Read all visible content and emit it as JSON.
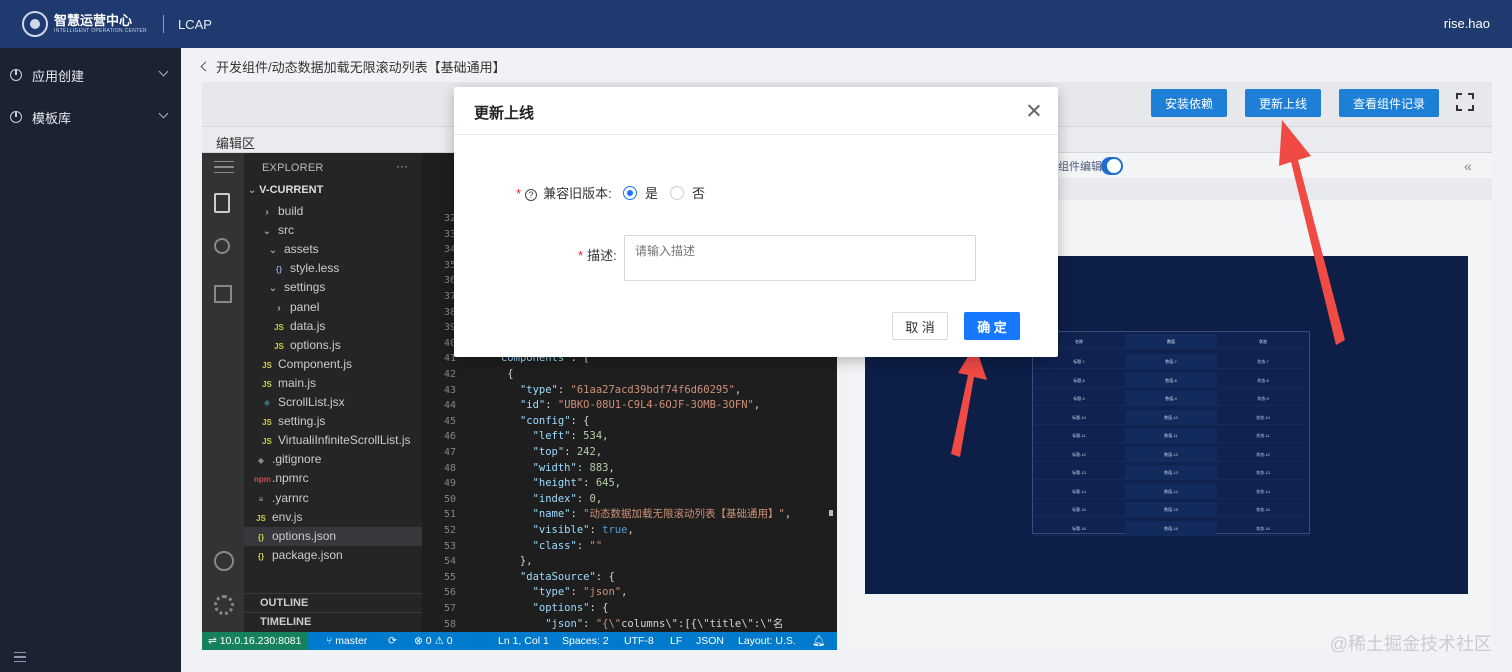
{
  "header": {
    "logo_cn": "智慧运营中心",
    "logo_en": "INTELLIGENT OPERATION CENTER",
    "app_name": "LCAP",
    "user": "rise.hao"
  },
  "sidebar": {
    "items": [
      {
        "label": "应用创建"
      },
      {
        "label": "模板库"
      }
    ]
  },
  "breadcrumb": {
    "text": "开发组件/动态数据加载无限滚动列表【基础通用】"
  },
  "toolbar": {
    "install_label": "安装依赖",
    "update_label": "更新上线",
    "history_label": "查看组件记录"
  },
  "editor": {
    "title": "编辑区",
    "explorer_title": "EXPLORER",
    "explorer_more": "···",
    "root": "V-CURRENT",
    "tree": [
      {
        "name": "build",
        "type": "folder"
      },
      {
        "name": "src",
        "type": "folder-open"
      },
      {
        "name": "assets",
        "type": "folder-open"
      },
      {
        "name": "style.less",
        "type": "less"
      },
      {
        "name": "settings",
        "type": "folder-open"
      },
      {
        "name": "panel",
        "type": "folder"
      },
      {
        "name": "data.js",
        "type": "js"
      },
      {
        "name": "options.js",
        "type": "js"
      },
      {
        "name": "Component.js",
        "type": "js"
      },
      {
        "name": "main.js",
        "type": "js"
      },
      {
        "name": "ScrollList.jsx",
        "type": "jsx"
      },
      {
        "name": "setting.js",
        "type": "js"
      },
      {
        "name": "VirtualiInfiniteScrollList.js",
        "type": "js"
      },
      {
        "name": ".gitignore",
        "type": "git"
      },
      {
        "name": ".npmrc",
        "type": "npm"
      },
      {
        "name": ".yarnrc",
        "type": "yarn"
      },
      {
        "name": "env.js",
        "type": "js"
      },
      {
        "name": "options.json",
        "type": "json"
      },
      {
        "name": "package.json",
        "type": "json"
      }
    ],
    "sections": [
      "OUTLINE",
      "TIMELINE"
    ],
    "line_numbers": [
      "32",
      "33",
      "34",
      "35",
      "36",
      "37",
      "38",
      "39",
      "40",
      "41",
      "42",
      "43",
      "44",
      "45",
      "46",
      "47",
      "48",
      "49",
      "50",
      "51",
      "52",
      "53",
      "54",
      "55",
      "56",
      "57",
      "58"
    ],
    "code_lines": [
      "",
      "",
      "",
      "",
      "",
      "",
      "",
      "",
      "",
      "  \"components\": [",
      "    {",
      "      \"type\": \"61aa27acd39bdf74f6d60295\",",
      "      \"id\": \"UBKO-08U1-C9L4-6OJF-3OMB-3OFN\",",
      "      \"config\": {",
      "        \"left\": 534,",
      "        \"top\": 242,",
      "        \"width\": 883,",
      "        \"height\": 645,",
      "        \"index\": 0,",
      "        \"name\": \"动态数据加载无限滚动列表【基础通用】\",",
      "        \"visible\": true,",
      "        \"class\": \"\"",
      "      },",
      "      \"dataSource\": {",
      "        \"type\": \"json\",",
      "        \"options\": {",
      "          \"json\": \"{\\\"columns\\\":[{\\\"title\\\":\\\"名"
    ],
    "status": {
      "remote": "10.0.16.230:8081",
      "branch": "master",
      "problems": "⊗ 0 ⚠ 0",
      "position": "Ln 1, Col 1",
      "spaces": "Spaces: 2",
      "encoding": "UTF-8",
      "eol": "LF",
      "language": "JSON",
      "layout": "Layout: U.S."
    }
  },
  "preview": {
    "toggle_label": "组件编辑",
    "table_header": [
      "名称",
      "数值",
      "状态"
    ],
    "table_rows": [
      [
        "标题-7",
        "数值-7",
        "状态-7"
      ],
      [
        "标题-8",
        "数值-8",
        "状态-8"
      ],
      [
        "标题-9",
        "数值-9",
        "状态-9"
      ],
      [
        "标题-10",
        "数值-10",
        "状态-10"
      ],
      [
        "标题-11",
        "数值-11",
        "状态-11"
      ],
      [
        "标题-12",
        "数值-12",
        "状态-12"
      ],
      [
        "标题-13",
        "数值-13",
        "状态-13"
      ],
      [
        "标题-14",
        "数值-14",
        "状态-14"
      ],
      [
        "标题-15",
        "数值-15",
        "状态-15"
      ],
      [
        "标题-16",
        "数值-16",
        "状态-16"
      ]
    ]
  },
  "modal": {
    "title": "更新上线",
    "compat_label": "兼容旧版本:",
    "option_yes": "是",
    "option_no": "否",
    "selected": "是",
    "desc_label": "描述:",
    "desc_placeholder": "请输入描述",
    "desc_value": "",
    "cancel_label": "取 消",
    "ok_label": "确 定"
  },
  "colors": {
    "header_bg": "#1f3a6e",
    "sidebar_bg": "#1b2333",
    "primary": "#1e7fd6",
    "modal_primary": "#1677ff",
    "arrow": "#f04a44"
  },
  "watermark": "@稀土掘金技术社区"
}
